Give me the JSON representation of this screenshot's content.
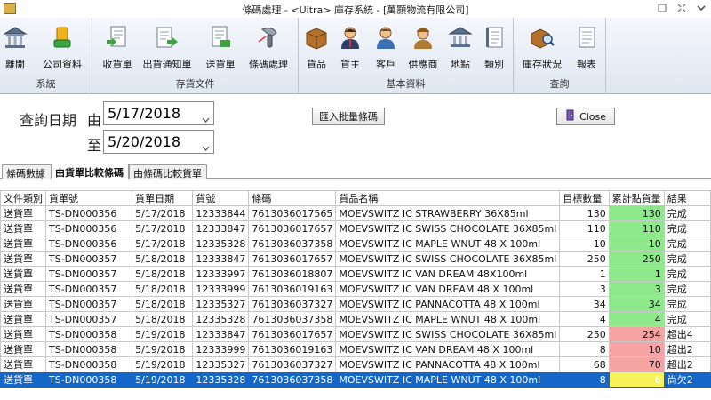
{
  "window": {
    "title": "條碼處理 - <Ultra> 庫存系統 - [萬顥物流有限公司]"
  },
  "ribbon": {
    "groups": [
      {
        "label": "系統",
        "buttons": [
          "離開",
          "公司資料"
        ]
      },
      {
        "label": "存貨文件",
        "buttons": [
          "收貨單",
          "出貨通知單",
          "送貨單",
          "條碼處理"
        ]
      },
      {
        "label": "基本資料",
        "buttons": [
          "貨品",
          "貨主",
          "客戶",
          "供應商",
          "地點",
          "類別"
        ]
      },
      {
        "label": "查詢",
        "buttons": [
          "庫存狀況",
          "報表"
        ]
      }
    ]
  },
  "filter": {
    "label_query_date": "查詢日期",
    "label_from": "由",
    "label_to": "至",
    "date_from": "5/17/2018",
    "date_to": "5/20/2018",
    "import_button": "匯入批量條碼",
    "close_button": "Close"
  },
  "tabs": [
    "條碼數據",
    "由貨單比較條碼",
    "由條碼比較貨單"
  ],
  "table": {
    "columns": [
      "文件類別",
      "貨單號",
      "貨單日期",
      "貨號",
      "條碼",
      "貨品名稱",
      "目標數量",
      "累計點貨量",
      "結果"
    ],
    "rows": [
      [
        "送貨單",
        "TS-DN000356",
        "5/17/2018",
        "12333844",
        "7613036017565",
        "MOEVSWITZ IC STRAWBERRY 36X85ml",
        "130",
        "130",
        "完成"
      ],
      [
        "送貨單",
        "TS-DN000356",
        "5/17/2018",
        "12333847",
        "7613036017657",
        "MOEVSWITZ IC SWISS CHOCOLATE 36X85ml",
        "110",
        "110",
        "完成"
      ],
      [
        "送貨單",
        "TS-DN000356",
        "5/17/2018",
        "12335328",
        "7613036037358",
        "MOEVSWITZ IC MAPLE WNUT 48 X 100ml",
        "10",
        "10",
        "完成"
      ],
      [
        "送貨單",
        "TS-DN000357",
        "5/18/2018",
        "12333847",
        "7613036017657",
        "MOEVSWITZ IC SWISS CHOCOLATE 36X85ml",
        "250",
        "250",
        "完成"
      ],
      [
        "送貨單",
        "TS-DN000357",
        "5/18/2018",
        "12333997",
        "7613036018807",
        "MOEVSWITZ IC VAN DREAM 48X100ml",
        "1",
        "1",
        "完成"
      ],
      [
        "送貨單",
        "TS-DN000357",
        "5/18/2018",
        "12333999",
        "7613036019163",
        "MOEVSWITZ IC VAN DREAM 48 X 100ml",
        "3",
        "3",
        "完成"
      ],
      [
        "送貨單",
        "TS-DN000357",
        "5/18/2018",
        "12335327",
        "7613036037327",
        "MOEVSWITZ IC PANNACOTTA 48 X 100ml",
        "34",
        "34",
        "完成"
      ],
      [
        "送貨單",
        "TS-DN000357",
        "5/18/2018",
        "12335328",
        "7613036037358",
        "MOEVSWITZ IC MAPLE WNUT 48 X 100ml",
        "4",
        "4",
        "完成"
      ],
      [
        "送貨單",
        "TS-DN000358",
        "5/19/2018",
        "12333847",
        "7613036017657",
        "MOEVSWITZ IC SWISS CHOCOLATE 36X85ml",
        "250",
        "254",
        "超出4"
      ],
      [
        "送貨單",
        "TS-DN000358",
        "5/19/2018",
        "12333999",
        "7613036019163",
        "MOEVSWITZ IC VAN DREAM 48 X 100ml",
        "8",
        "10",
        "超出2"
      ],
      [
        "送貨單",
        "TS-DN000358",
        "5/19/2018",
        "12335327",
        "7613036037327",
        "MOEVSWITZ IC PANNACOTTA 48 X 100ml",
        "68",
        "70",
        "超出2"
      ],
      [
        "送貨單",
        "TS-DN000358",
        "5/19/2018",
        "12335328",
        "7613036037358",
        "MOEVSWITZ IC MAPLE WNUT 48 X 100ml",
        "8",
        "6",
        "尚欠2"
      ]
    ],
    "count_status": [
      "green",
      "green",
      "green",
      "green",
      "green",
      "green",
      "green",
      "green",
      "red",
      "red",
      "red",
      "yellow"
    ],
    "selected_row": 11
  },
  "colors": {
    "complete": "#8ee98b",
    "over": "#f5a3a3",
    "short": "#f7f257",
    "selection": "#1467c9"
  },
  "icons": {
    "ribbon": [
      "exit-building-icon",
      "company-data-icon",
      "receiving-note-icon",
      "shipping-notice-icon",
      "delivery-note-icon",
      "barcode-scanner-icon",
      "goods-box-icon",
      "owner-person-icon",
      "customer-person-icon",
      "supplier-person-icon",
      "location-building-icon",
      "category-book-icon",
      "stock-status-icon",
      "report-icon"
    ]
  }
}
